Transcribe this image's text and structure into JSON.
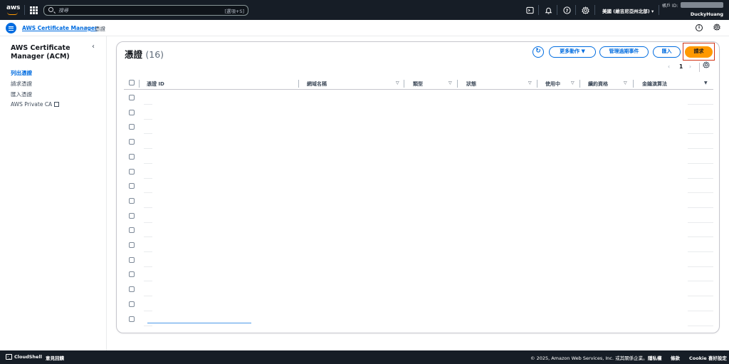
{
  "topnav": {
    "logo_text": "aws",
    "search_placeholder": "搜尋",
    "search_shortcut": "[選項+S]",
    "region": "美國 (維吉尼亞州北部) ▾",
    "account_id_label": "帳戶 ID:",
    "username": "DuckyHuang"
  },
  "breadcrumb": {
    "service": "AWS Certificate Manager",
    "current": "憑證"
  },
  "sidebar": {
    "title": "AWS Certificate Manager (ACM)",
    "items": [
      {
        "label": "列出憑證",
        "active": true
      },
      {
        "label": "請求憑證",
        "active": false
      },
      {
        "label": "匯入憑證",
        "active": false
      },
      {
        "label": "AWS Private CA",
        "active": false,
        "external": true
      }
    ]
  },
  "main": {
    "title": "憑證",
    "count": "(16)",
    "buttons": {
      "more_actions": "更多動作 ▼",
      "manage_expiry": "管理過期事件",
      "import": "匯入",
      "request": "請求"
    },
    "pagination": {
      "prev": "‹",
      "page": "1",
      "next": "›"
    },
    "columns": [
      "憑證 ID",
      "網域名稱",
      "類型",
      "狀態",
      "使用中",
      "續約資格",
      "金鑰演算法"
    ],
    "row_count": 16
  },
  "footer": {
    "cloudshell": "CloudShell",
    "feedback": "意見回饋",
    "copyright": "© 2025, Amazon Web Services, Inc. 或其關係企業。",
    "privacy": "隱私權",
    "terms": "條款",
    "cookie": "Cookie 喜好設定"
  }
}
